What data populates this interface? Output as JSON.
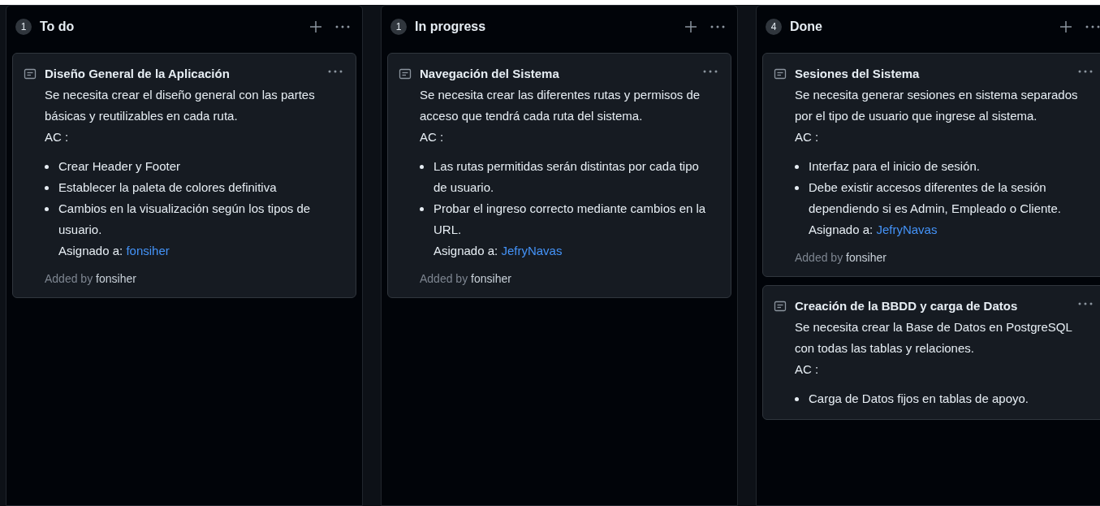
{
  "columns": [
    {
      "count": "1",
      "title": "To do",
      "cards": [
        {
          "title": "Diseño General de la Aplicación",
          "description": "Se necesita crear el diseño general con las partes básicas y reutilizables en cada ruta.",
          "ac": "AC :",
          "items": [
            "Crear Header y Footer",
            "Establecer la paleta de colores definitiva",
            "Cambios en la visualización según los tipos de usuario."
          ],
          "assigned_label": "Asignado a:",
          "assignee": "fonsiher",
          "added_label": "Added by",
          "added_by": "fonsiher"
        }
      ]
    },
    {
      "count": "1",
      "title": "In progress",
      "cards": [
        {
          "title": "Navegación del Sistema",
          "description": "Se necesita crear las diferentes rutas y permisos de acceso que tendrá cada ruta del sistema.",
          "ac": "AC :",
          "items": [
            "Las rutas permitidas serán distintas por cada tipo de usuario.",
            "Probar el ingreso correcto mediante cambios en la URL."
          ],
          "assigned_label": "Asignado a:",
          "assignee": "JefryNavas",
          "added_label": "Added by",
          "added_by": "fonsiher"
        }
      ]
    },
    {
      "count": "4",
      "title": "Done",
      "cards": [
        {
          "title": "Sesiones del Sistema",
          "description": "Se necesita generar sesiones en sistema separados por el tipo de usuario que ingrese al sistema.",
          "ac": "AC :",
          "items": [
            "Interfaz para el inicio de sesión.",
            "Debe existir accesos diferentes de la sesión dependiendo si es Admin, Empleado o Cliente."
          ],
          "assigned_label": "Asignado a:",
          "assignee": "JefryNavas",
          "added_label": "Added by",
          "added_by": "fonsiher"
        },
        {
          "title": "Creación de la BBDD y carga de Datos",
          "description": "Se necesita crear la Base de Datos en PostgreSQL con todas las tablas y relaciones.",
          "ac": "AC :",
          "items": [
            "Carga de Datos fijos en tablas de apoyo."
          ]
        }
      ]
    }
  ]
}
